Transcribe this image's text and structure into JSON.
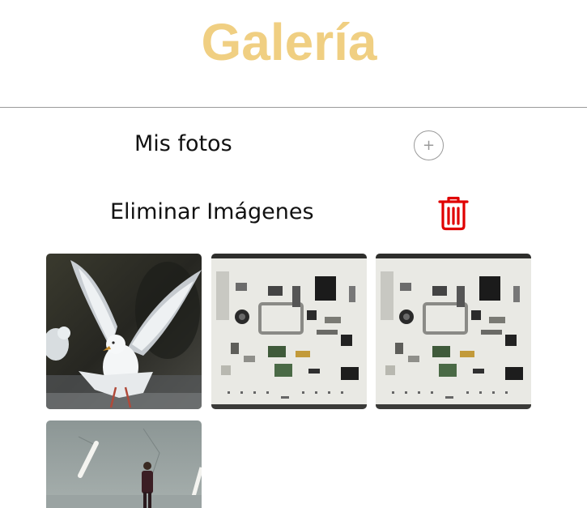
{
  "header": {
    "title": "Galería",
    "title_color": "#f0cf82"
  },
  "actions": {
    "my_photos_label": "Mis fotos",
    "add_icon": "plus-circle-icon",
    "delete_label": "Eliminar Imágenes",
    "delete_icon": "trash-icon",
    "delete_color": "#e00000"
  },
  "gallery": {
    "photos": [
      {
        "subject": "seagull-landing"
      },
      {
        "subject": "disassembled-electronics-flatlay"
      },
      {
        "subject": "disassembled-electronics-flatlay"
      },
      {
        "subject": "man-walking-street"
      }
    ]
  }
}
